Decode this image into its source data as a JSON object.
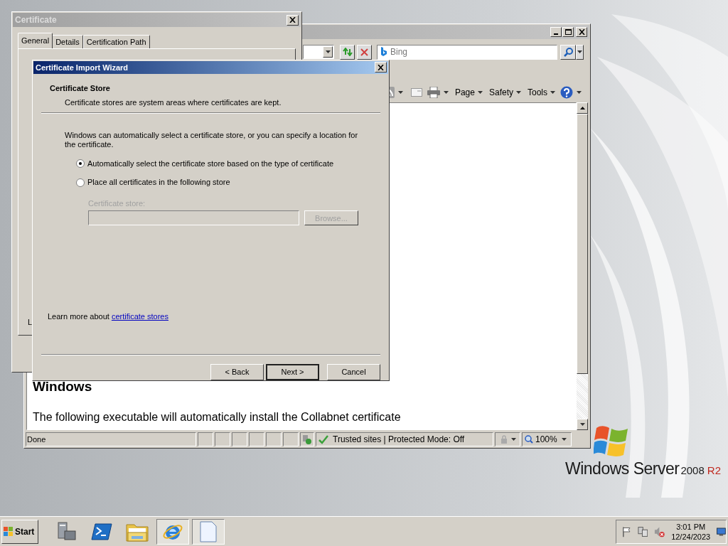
{
  "browser": {
    "search": {
      "placeholder": "Bing"
    },
    "command_bar": [
      {
        "label": "Page"
      },
      {
        "label": "Safety"
      },
      {
        "label": "Tools"
      }
    ],
    "content": {
      "heading": "Windows",
      "paragraph": "The following executable will automatically install the Collabnet certificate"
    },
    "status_bar": {
      "status": "Done",
      "zone": "Trusted sites | Protected Mode: Off",
      "zoom": "100%"
    }
  },
  "certificate_window": {
    "title": "Certificate",
    "tabs": [
      {
        "label": "General",
        "selected": true
      },
      {
        "label": "Details",
        "selected": false
      },
      {
        "label": "Certification Path",
        "selected": false
      }
    ],
    "footer_fragment": "L"
  },
  "wizard": {
    "title": "Certificate Import Wizard",
    "section_title": "Certificate Store",
    "section_subtitle": "Certificate stores are system areas where certificates are kept.",
    "description": "Windows can automatically select a certificate store, or you can specify a location for the certificate.",
    "options": [
      {
        "label": "Automatically select the certificate store based on the type of certificate",
        "selected": true
      },
      {
        "label": "Place all certificates in the following store",
        "selected": false
      }
    ],
    "store": {
      "label": "Certificate store:",
      "browse": "Browse...",
      "disabled": true
    },
    "learn_more": "Learn more about",
    "learn_more_link": "certificate stores",
    "buttons": [
      {
        "label": "< Back",
        "default": false
      },
      {
        "label": "Next >",
        "default": true
      },
      {
        "label": "Cancel",
        "default": false
      }
    ]
  },
  "taskbar": {
    "start": "Start",
    "items": [
      {
        "kind": "server-manager",
        "selected": false
      },
      {
        "kind": "powershell",
        "selected": false
      },
      {
        "kind": "explorer",
        "selected": false
      },
      {
        "kind": "browser",
        "selected": true
      },
      {
        "kind": "document",
        "selected": true
      }
    ],
    "clock": {
      "time": "3:01 PM",
      "date": "12/24/2023"
    }
  },
  "desktop_logo": {
    "brand": "Windows Server",
    "version": "2008",
    "edition": "R2"
  }
}
